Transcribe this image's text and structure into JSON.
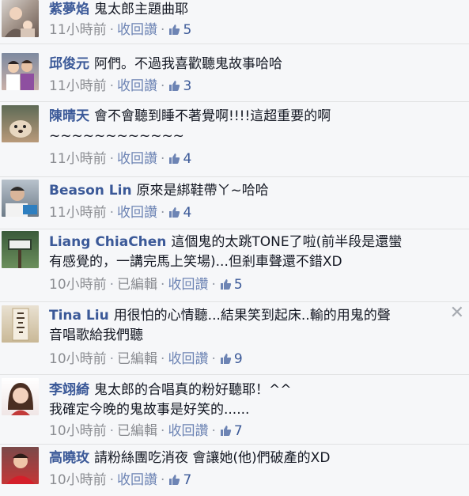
{
  "comments": [
    {
      "author": "紫夢焰",
      "text": "鬼太郎主題曲耶",
      "time": "11小時前",
      "edited": "",
      "unlike": "收回讚",
      "likes": "5",
      "avatar_icon": "avatar-woman-with-baby"
    },
    {
      "author": "邱俊元",
      "text": "阿們。不過我喜歡聽鬼故事哈哈",
      "time": "11小時前",
      "edited": "",
      "unlike": "收回讚",
      "likes": "3",
      "avatar_icon": "avatar-couple"
    },
    {
      "author": "陳晴天",
      "text": "會不會聽到睡不著覺啊!!!!這超重要的啊",
      "text2": "~~~~~~~~~~~~",
      "time": "11小時前",
      "edited": "",
      "unlike": "收回讚",
      "likes": "4",
      "avatar_icon": "avatar-dog"
    },
    {
      "author": "Beason Lin",
      "text": "原來是綁鞋帶ㄚ~哈哈",
      "time": "11小時前",
      "edited": "",
      "unlike": "收回讚",
      "likes": "4",
      "avatar_icon": "avatar-man"
    },
    {
      "author": "Liang ChiaChen",
      "text": "這個鬼的太跳TONE了啦(前半段是還蠻",
      "text2": "有感覺的，一講完馬上笑場)...但剎車聲還不錯XD",
      "time": "10小時前",
      "edited": "已編輯",
      "unlike": "收回讚",
      "likes": "5",
      "avatar_icon": "avatar-sign"
    },
    {
      "author": "Tina Liu",
      "text": "用很怕的心情聽...結果笑到起床..輸的用鬼的聲",
      "text2": "音唱歌給我們聽",
      "time": "10小時前",
      "edited": "已編輯",
      "unlike": "收回讚",
      "likes": "9",
      "avatar_icon": "avatar-calligraphy",
      "close_icon": "close-icon",
      "close_label": "✕"
    },
    {
      "author": "李翊綺",
      "text": "鬼太郎的合唱真的粉好聽耶！^^",
      "text2": "我確定今晚的鬼故事是好笑的......",
      "time": "10小時前",
      "edited": "已編輯",
      "unlike": "收回讚",
      "likes": "7",
      "avatar_icon": "avatar-woman"
    },
    {
      "author": "高曉玫",
      "text": "請粉絲團吃消夜 會讓她(他)們破產的XD",
      "time": "10小時前",
      "edited": "",
      "unlike": "收回讚",
      "likes": "7",
      "avatar_icon": "avatar-woman-red"
    }
  ],
  "separator": "·",
  "colors": {
    "author": "#3b5998",
    "meta": "#8b8d92",
    "background": "#f6f7f9"
  }
}
